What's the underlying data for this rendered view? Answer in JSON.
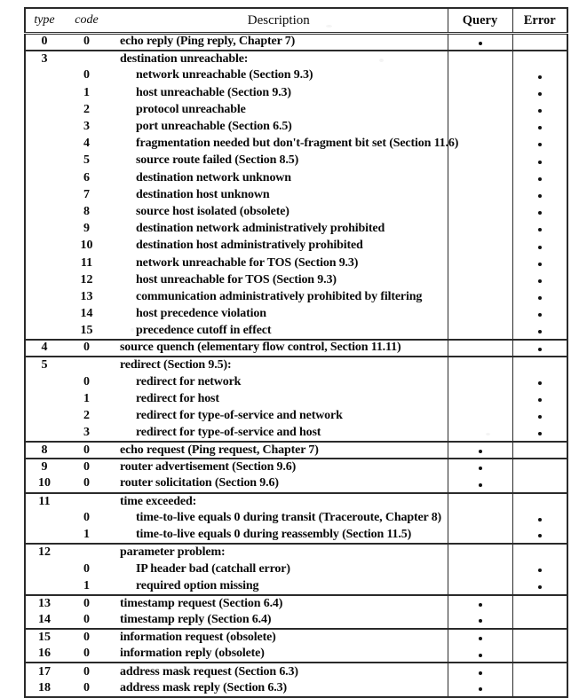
{
  "table": {
    "caption_columns": {
      "type": "type",
      "code": "code",
      "description": "Description",
      "query": "Query",
      "error": "Error"
    },
    "dot_glyph": "•",
    "rows": [
      {
        "group_start": true,
        "type": "0",
        "code": "0",
        "indent": 0,
        "description": "echo reply (Ping reply, Chapter 7)",
        "query": true,
        "error": false
      },
      {
        "group_start": true,
        "type": "3",
        "code": "",
        "indent": 0,
        "description": "destination unreachable:",
        "query": false,
        "error": false
      },
      {
        "group_start": false,
        "type": "",
        "code": "0",
        "indent": 1,
        "description": "network unreachable (Section 9.3)",
        "query": false,
        "error": true
      },
      {
        "group_start": false,
        "type": "",
        "code": "1",
        "indent": 1,
        "description": "host unreachable (Section 9.3)",
        "query": false,
        "error": true
      },
      {
        "group_start": false,
        "type": "",
        "code": "2",
        "indent": 1,
        "description": "protocol unreachable",
        "query": false,
        "error": true
      },
      {
        "group_start": false,
        "type": "",
        "code": "3",
        "indent": 1,
        "description": "port unreachable (Section 6.5)",
        "query": false,
        "error": true
      },
      {
        "group_start": false,
        "type": "",
        "code": "4",
        "indent": 1,
        "description": "fragmentation needed but don't-fragment bit set (Section 11.6)",
        "query": false,
        "error": true
      },
      {
        "group_start": false,
        "type": "",
        "code": "5",
        "indent": 1,
        "description": "source route failed (Section 8.5)",
        "query": false,
        "error": true
      },
      {
        "group_start": false,
        "type": "",
        "code": "6",
        "indent": 1,
        "description": "destination network unknown",
        "query": false,
        "error": true
      },
      {
        "group_start": false,
        "type": "",
        "code": "7",
        "indent": 1,
        "description": "destination host unknown",
        "query": false,
        "error": true
      },
      {
        "group_start": false,
        "type": "",
        "code": "8",
        "indent": 1,
        "description": "source host isolated (obsolete)",
        "query": false,
        "error": true
      },
      {
        "group_start": false,
        "type": "",
        "code": "9",
        "indent": 1,
        "description": "destination network administratively prohibited",
        "query": false,
        "error": true
      },
      {
        "group_start": false,
        "type": "",
        "code": "10",
        "indent": 1,
        "description": "destination host administratively prohibited",
        "query": false,
        "error": true
      },
      {
        "group_start": false,
        "type": "",
        "code": "11",
        "indent": 1,
        "description": "network unreachable for TOS (Section 9.3)",
        "query": false,
        "error": true
      },
      {
        "group_start": false,
        "type": "",
        "code": "12",
        "indent": 1,
        "description": "host unreachable for TOS (Section 9.3)",
        "query": false,
        "error": true
      },
      {
        "group_start": false,
        "type": "",
        "code": "13",
        "indent": 1,
        "description": "communication administratively prohibited by filtering",
        "query": false,
        "error": true
      },
      {
        "group_start": false,
        "type": "",
        "code": "14",
        "indent": 1,
        "description": "host precedence violation",
        "query": false,
        "error": true
      },
      {
        "group_start": false,
        "type": "",
        "code": "15",
        "indent": 1,
        "description": "precedence cutoff in effect",
        "query": false,
        "error": true
      },
      {
        "group_start": true,
        "type": "4",
        "code": "0",
        "indent": 0,
        "description": "source quench (elementary flow control, Section 11.11)",
        "query": false,
        "error": true
      },
      {
        "group_start": true,
        "type": "5",
        "code": "",
        "indent": 0,
        "description": "redirect (Section 9.5):",
        "query": false,
        "error": false
      },
      {
        "group_start": false,
        "type": "",
        "code": "0",
        "indent": 1,
        "description": "redirect for network",
        "query": false,
        "error": true
      },
      {
        "group_start": false,
        "type": "",
        "code": "1",
        "indent": 1,
        "description": "redirect for host",
        "query": false,
        "error": true
      },
      {
        "group_start": false,
        "type": "",
        "code": "2",
        "indent": 1,
        "description": "redirect for type-of-service and network",
        "query": false,
        "error": true
      },
      {
        "group_start": false,
        "type": "",
        "code": "3",
        "indent": 1,
        "description": "redirect for type-of-service and host",
        "query": false,
        "error": true
      },
      {
        "group_start": true,
        "type": "8",
        "code": "0",
        "indent": 0,
        "description": "echo request (Ping request, Chapter 7)",
        "query": true,
        "error": false
      },
      {
        "group_start": true,
        "type": "9",
        "code": "0",
        "indent": 0,
        "description": "router advertisement (Section 9.6)",
        "query": true,
        "error": false
      },
      {
        "group_start": false,
        "type": "10",
        "code": "0",
        "indent": 0,
        "description": "router solicitation (Section 9.6)",
        "query": true,
        "error": false
      },
      {
        "group_start": true,
        "type": "11",
        "code": "",
        "indent": 0,
        "description": "time exceeded:",
        "query": false,
        "error": false
      },
      {
        "group_start": false,
        "type": "",
        "code": "0",
        "indent": 1,
        "description": "time-to-live equals 0 during transit (Traceroute, Chapter 8)",
        "query": false,
        "error": true
      },
      {
        "group_start": false,
        "type": "",
        "code": "1",
        "indent": 1,
        "description": "time-to-live equals 0 during reassembly (Section 11.5)",
        "query": false,
        "error": true
      },
      {
        "group_start": true,
        "type": "12",
        "code": "",
        "indent": 0,
        "description": "parameter problem:",
        "query": false,
        "error": false
      },
      {
        "group_start": false,
        "type": "",
        "code": "0",
        "indent": 1,
        "description": "IP header bad (catchall error)",
        "query": false,
        "error": true
      },
      {
        "group_start": false,
        "type": "",
        "code": "1",
        "indent": 1,
        "description": "required option missing",
        "query": false,
        "error": true
      },
      {
        "group_start": true,
        "type": "13",
        "code": "0",
        "indent": 0,
        "description": "timestamp request (Section 6.4)",
        "query": true,
        "error": false
      },
      {
        "group_start": false,
        "type": "14",
        "code": "0",
        "indent": 0,
        "description": "timestamp reply (Section 6.4)",
        "query": true,
        "error": false
      },
      {
        "group_start": true,
        "type": "15",
        "code": "0",
        "indent": 0,
        "description": "information request (obsolete)",
        "query": true,
        "error": false
      },
      {
        "group_start": false,
        "type": "16",
        "code": "0",
        "indent": 0,
        "description": "information reply (obsolete)",
        "query": true,
        "error": false
      },
      {
        "group_start": true,
        "type": "17",
        "code": "0",
        "indent": 0,
        "description": "address mask request (Section 6.3)",
        "query": true,
        "error": false
      },
      {
        "group_start": false,
        "type": "18",
        "code": "0",
        "indent": 0,
        "description": "address mask reply (Section 6.3)",
        "query": true,
        "error": false
      }
    ]
  }
}
